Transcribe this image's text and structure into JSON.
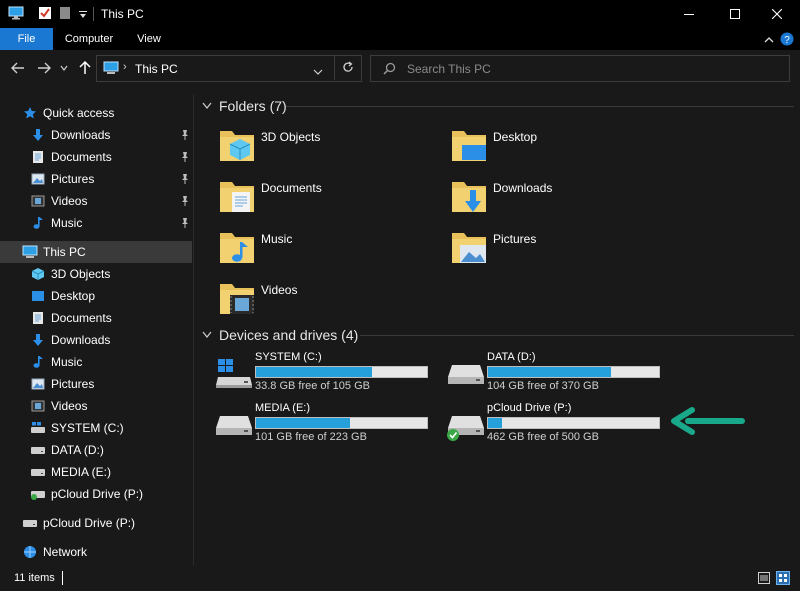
{
  "window": {
    "title": "This PC"
  },
  "ribbon": {
    "tabs": [
      {
        "label": "File"
      },
      {
        "label": "Computer"
      },
      {
        "label": "View"
      }
    ]
  },
  "address": {
    "crumb": "This PC"
  },
  "search": {
    "placeholder": "Search This PC"
  },
  "sidebar": {
    "items": [
      {
        "label": "Quick access"
      },
      {
        "label": "Downloads"
      },
      {
        "label": "Documents"
      },
      {
        "label": "Pictures"
      },
      {
        "label": "Videos"
      },
      {
        "label": "Music"
      },
      {
        "label": "This PC"
      },
      {
        "label": "3D Objects"
      },
      {
        "label": "Desktop"
      },
      {
        "label": "Documents"
      },
      {
        "label": "Downloads"
      },
      {
        "label": "Music"
      },
      {
        "label": "Pictures"
      },
      {
        "label": "Videos"
      },
      {
        "label": "SYSTEM (C:)"
      },
      {
        "label": "DATA (D:)"
      },
      {
        "label": "MEDIA (E:)"
      },
      {
        "label": "pCloud Drive (P:)"
      },
      {
        "label": "pCloud Drive (P:)"
      },
      {
        "label": "Network"
      }
    ]
  },
  "main": {
    "folders_header": "Folders (7)",
    "folders": [
      {
        "name": "3D Objects"
      },
      {
        "name": "Desktop"
      },
      {
        "name": "Documents"
      },
      {
        "name": "Downloads"
      },
      {
        "name": "Music"
      },
      {
        "name": "Pictures"
      },
      {
        "name": "Videos"
      }
    ],
    "drives_header": "Devices and drives (4)",
    "drives": [
      {
        "name": "SYSTEM (C:)",
        "free": "33.8 GB free of 105 GB",
        "used_fraction": 0.68
      },
      {
        "name": "DATA (D:)",
        "free": "104 GB free of 370 GB",
        "used_fraction": 0.72
      },
      {
        "name": "MEDIA (E:)",
        "free": "101 GB free of 223 GB",
        "used_fraction": 0.55
      },
      {
        "name": "pCloud Drive (P:)",
        "free": "462 GB free of 500 GB",
        "used_fraction": 0.08
      }
    ]
  },
  "status": {
    "items": "11 items"
  },
  "colors": {
    "accent": "#1a78d3",
    "bar_fill": "#26a0da",
    "folder": "#e8c15a",
    "arrow": "#1aa88a"
  }
}
